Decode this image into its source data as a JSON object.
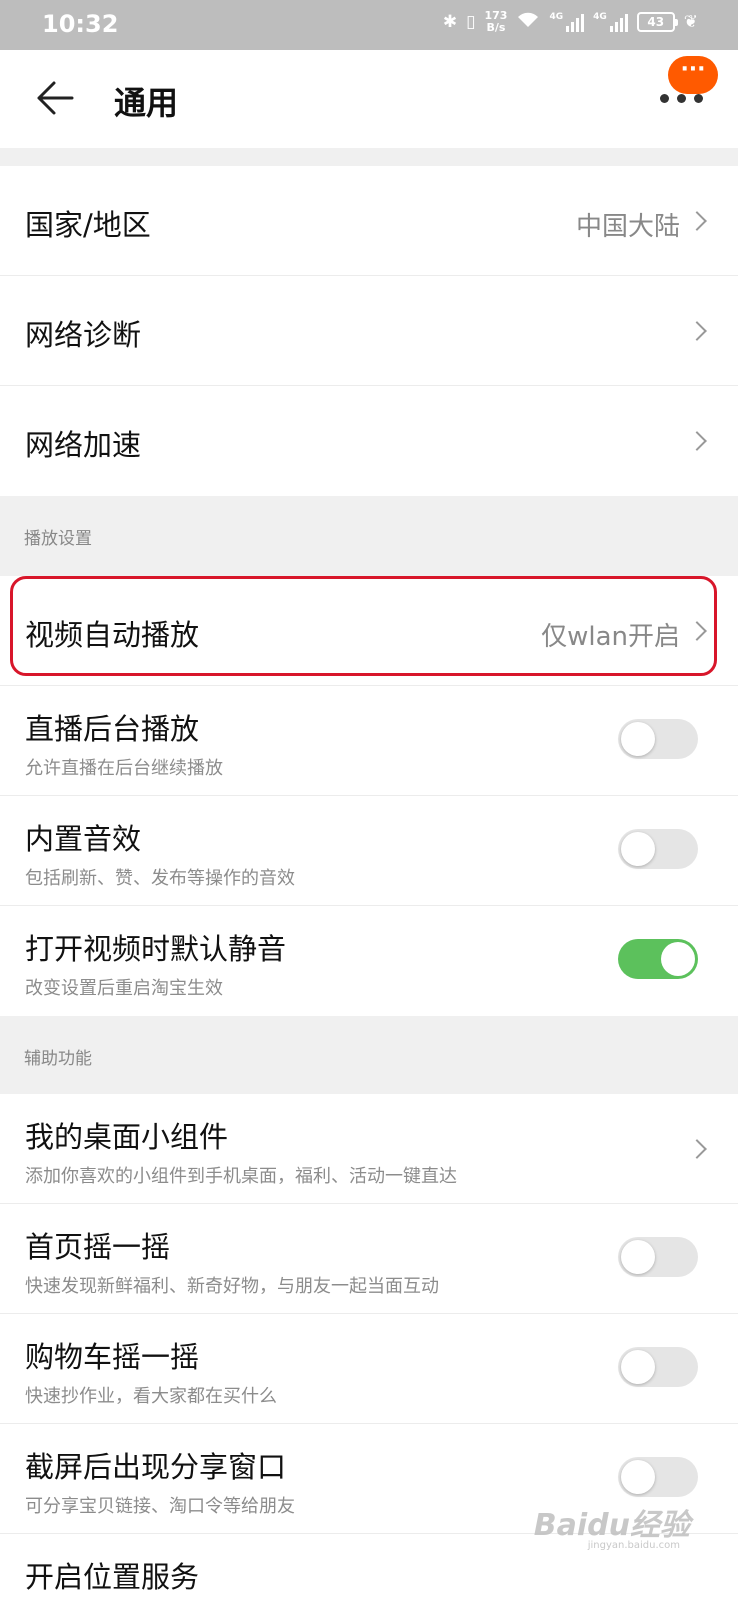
{
  "status_bar": {
    "time": "10:32",
    "net_speed_value": "173",
    "net_speed_unit": "B/s",
    "signal_tag_1": "4G",
    "signal_tag_2": "4G",
    "battery": "43"
  },
  "header": {
    "title": "通用",
    "badge": "···"
  },
  "rows": {
    "region": {
      "label": "国家/地区",
      "value": "中国大陆"
    },
    "network_diagnosis": {
      "label": "网络诊断"
    },
    "network_acceleration": {
      "label": "网络加速"
    },
    "video_autoplay": {
      "label": "视频自动播放",
      "value": "仅wlan开启"
    },
    "live_background": {
      "label": "直播后台播放",
      "sub": "允许直播在后台继续播放",
      "enabled": false
    },
    "builtin_sound": {
      "label": "内置音效",
      "sub": "包括刷新、赞、发布等操作的音效",
      "enabled": false
    },
    "mute_default": {
      "label": "打开视频时默认静音",
      "sub": "改变设置后重启淘宝生效",
      "enabled": true
    },
    "desktop_widget": {
      "label": "我的桌面小组件",
      "sub": "添加你喜欢的小组件到手机桌面，福利、活动一键直达"
    },
    "home_shake": {
      "label": "首页摇一摇",
      "sub": "快速发现新鲜福利、新奇好物，与朋友一起当面互动",
      "enabled": false
    },
    "cart_shake": {
      "label": "购物车摇一摇",
      "sub": "快速抄作业，看大家都在买什么",
      "enabled": false
    },
    "screenshot_share": {
      "label": "截屏后出现分享窗口",
      "sub": "可分享宝贝链接、淘口令等给朋友",
      "enabled": false
    },
    "location_service": {
      "label": "开启位置服务"
    }
  },
  "sections": {
    "playback": "播放设置",
    "accessibility": "辅助功能"
  },
  "watermark": {
    "main": "Baidu经验",
    "sub": "jingyan.baidu.com"
  },
  "colors": {
    "accent_orange": "#ff5a00",
    "toggle_on": "#5cc15c",
    "highlight_red": "#d8162a"
  }
}
